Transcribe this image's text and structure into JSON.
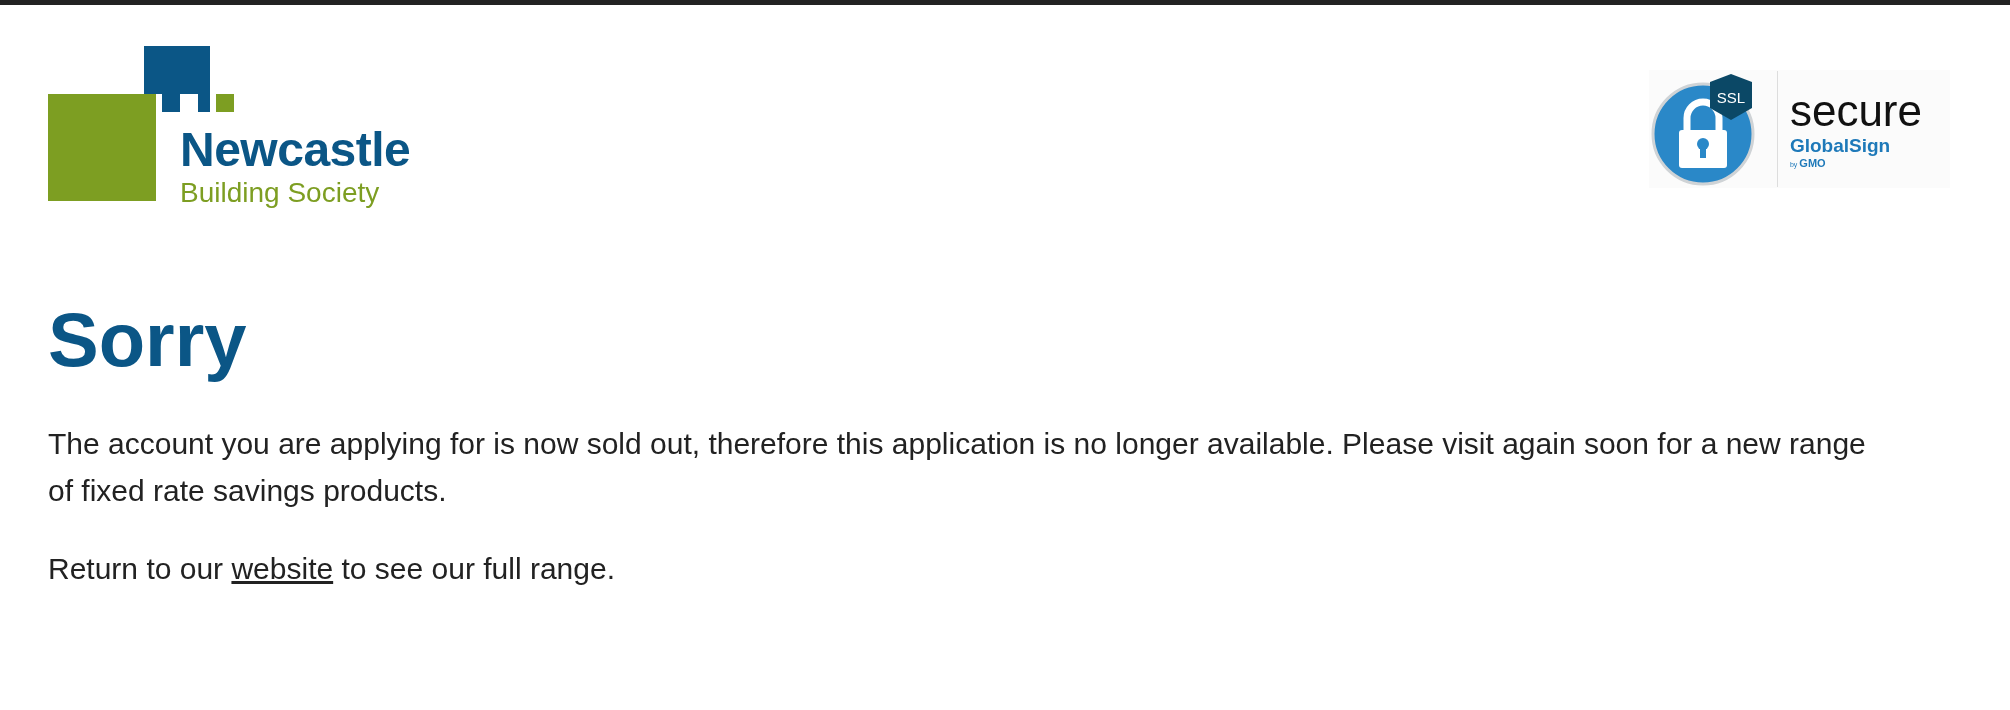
{
  "logo": {
    "name": "Newcastle",
    "subtitle": "Building Society"
  },
  "badge": {
    "ssl": "SSL",
    "word": "secure",
    "brand": "GlobalSign",
    "by": "by",
    "maker": "GMO"
  },
  "heading": "Sorry",
  "message": "The account you are applying for is now sold out, therefore this application is no longer available. Please visit again soon for a new range of fixed rate savings products.",
  "return_line": {
    "before": "Return to our",
    "link": "website",
    "after": "to see our full range."
  }
}
